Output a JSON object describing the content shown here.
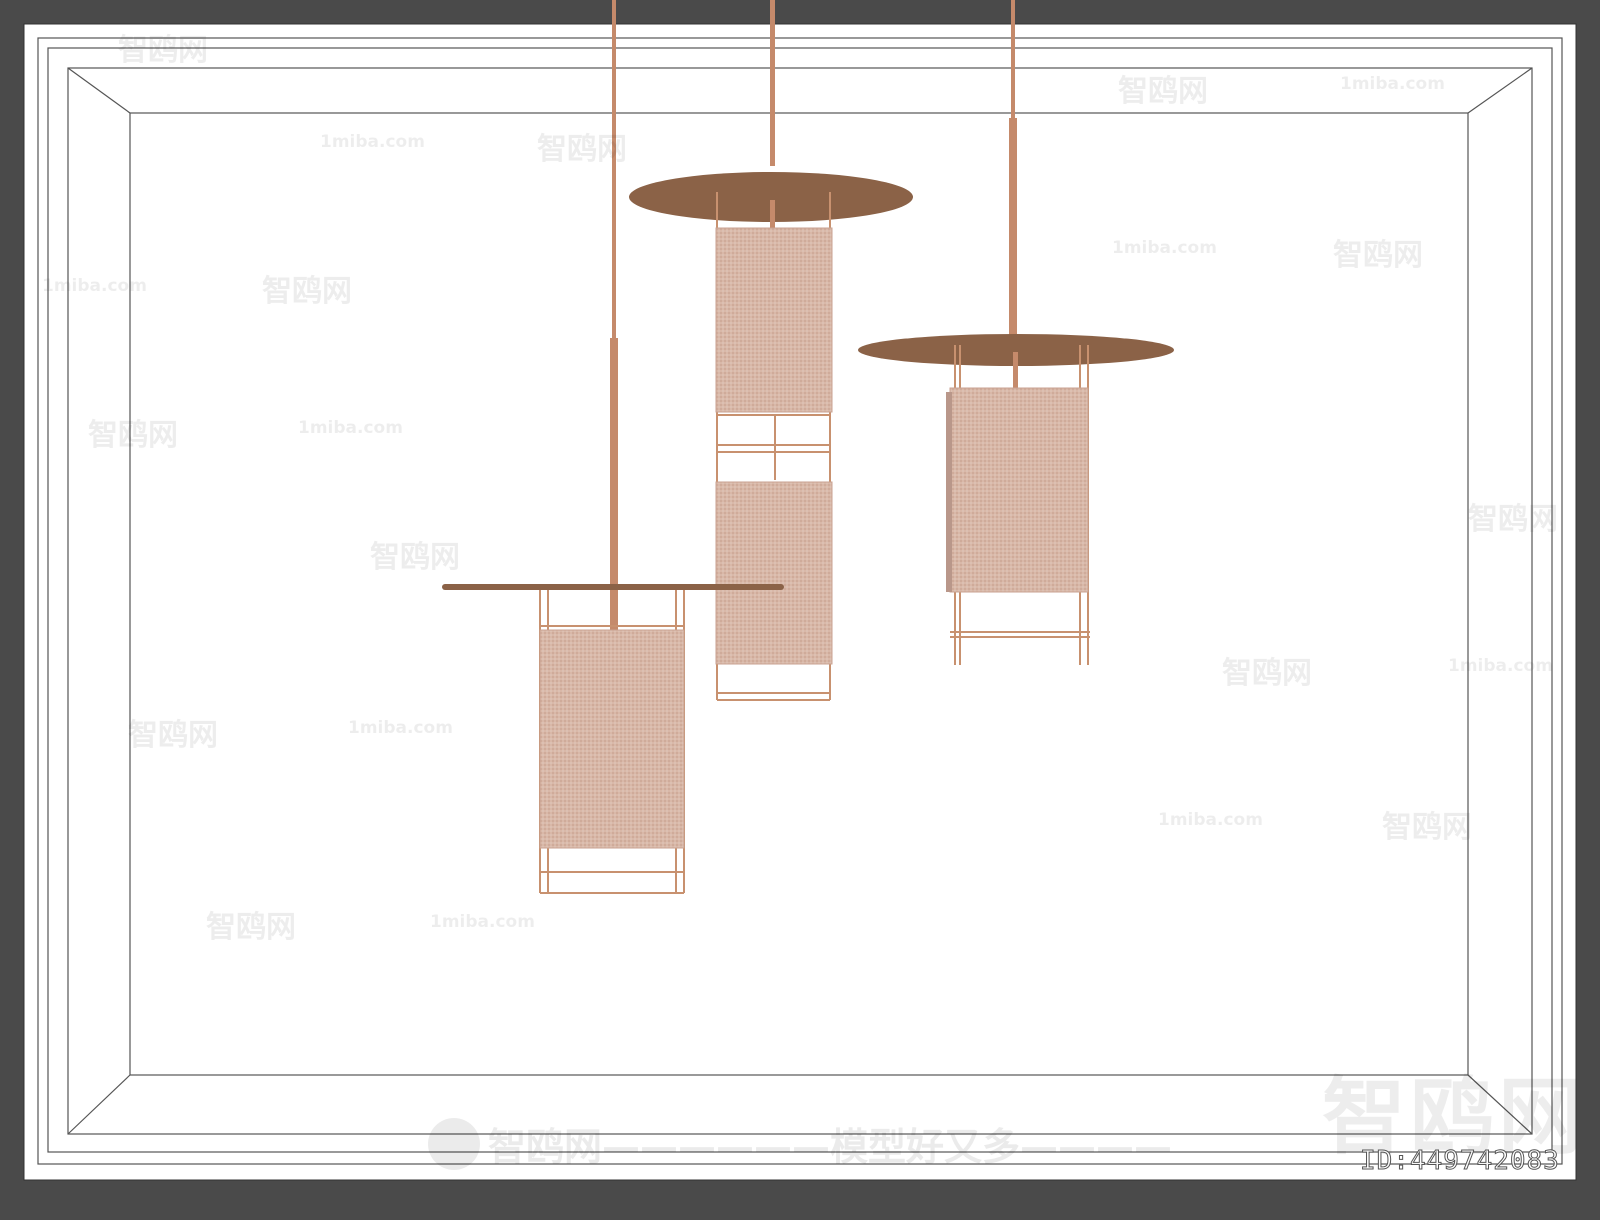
{
  "watermark": {
    "brand_cn": "智鸥网",
    "brand_en": "1miba.com",
    "slogan": "智鸥网——————模型好又多————",
    "id_text": "ID:449742083",
    "big_brand": "智鸥网"
  },
  "colors": {
    "outer_frame": "#4a4a4a",
    "paper": "#ffffff",
    "line": "#5a5a5a",
    "disc": "#8b6247",
    "rod": "#c58a6b",
    "shade": "#d6b4a4",
    "frame_wire": "#c8916f"
  }
}
